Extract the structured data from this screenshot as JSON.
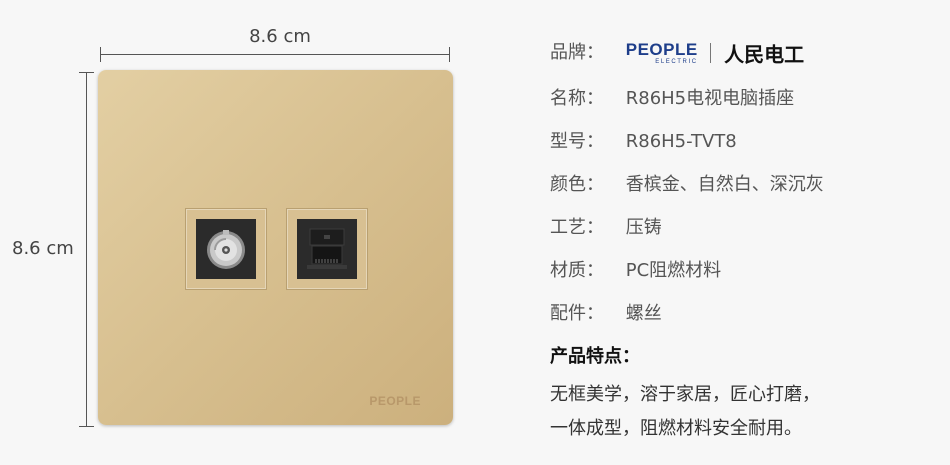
{
  "dimensions": {
    "width_label": "8.6 cm",
    "height_label": "8.6 cm"
  },
  "panel": {
    "brand_mark": "PEOPLE",
    "colors": {
      "panel": "#d7bf8f",
      "port": "#2b2b2b"
    }
  },
  "info": {
    "brand": {
      "key": "品牌：",
      "logo_en": "PEOPLE",
      "logo_en_sub": "ELECTRIC",
      "logo_cn": "人民电工"
    },
    "name": {
      "key": "名称：",
      "value": "R86H5电视电脑插座"
    },
    "model": {
      "key": "型号：",
      "value": "R86H5-TVT8"
    },
    "color": {
      "key": "颜色：",
      "value": "香槟金、自然白、深沉灰"
    },
    "process": {
      "key": "工艺：",
      "value": "压铸"
    },
    "material": {
      "key": "材质：",
      "value": "PC阻燃材料"
    },
    "accessory": {
      "key": "配件：",
      "value": "螺丝"
    }
  },
  "features": {
    "title": "产品特点：",
    "line1": "无框美学，溶于家居，匠心打磨，",
    "line2": "一体成型，阻燃材料安全耐用。"
  }
}
